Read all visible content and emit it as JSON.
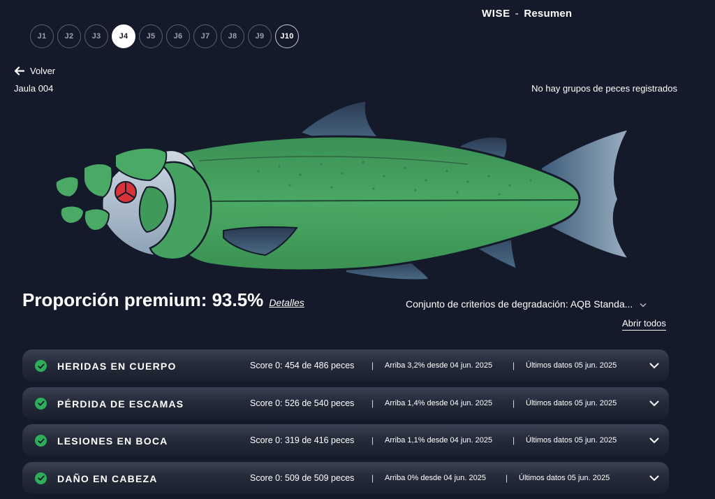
{
  "header": {
    "app": "WISE",
    "separator": "-",
    "section": "Resumen"
  },
  "cage_tabs": [
    {
      "label": "J1"
    },
    {
      "label": "J2"
    },
    {
      "label": "J3"
    },
    {
      "label": "J4"
    },
    {
      "label": "J5"
    },
    {
      "label": "J6"
    },
    {
      "label": "J7"
    },
    {
      "label": "J8"
    },
    {
      "label": "J9"
    },
    {
      "label": "J10"
    }
  ],
  "selected_cage": "J4",
  "nav": {
    "back_label": "Volver"
  },
  "cage": {
    "name": "Jaula 004"
  },
  "fish_groups": {
    "empty_message": "No hay grupos de peces registrados"
  },
  "summary": {
    "premium_label": "Proporción premium: 93.5%",
    "premium_value": 93.5,
    "details_link": "Detalles"
  },
  "criteria": {
    "label": "Conjunto de criterios de degradación: AQB Standa..."
  },
  "actions": {
    "open_all": "Abrir todos"
  },
  "colors": {
    "background": "#141a2a",
    "ok_green": "#2fae5a",
    "fish_green": "#3fa35a",
    "alert_red": "#d8323a"
  },
  "categories": [
    {
      "name": "HERIDAS EN CUERPO",
      "status": "ok",
      "score": "Score 0: 454 de 486 peces",
      "trend": "Arriba 3,2%  desde 04 jun. 2025",
      "latest": "Últimos datos 05 jun. 2025"
    },
    {
      "name": "PÉRDIDA DE ESCAMAS",
      "status": "ok",
      "score": "Score 0: 526 de 540 peces",
      "trend": "Arriba 1,4%  desde 04 jun. 2025",
      "latest": "Últimos datos 05 jun. 2025"
    },
    {
      "name": "LESIONES EN BOCA",
      "status": "ok",
      "score": "Score 0: 319 de 416 peces",
      "trend": "Arriba 1,1%  desde 04 jun. 2025",
      "latest": "Últimos datos 05 jun. 2025"
    },
    {
      "name": "DAÑO EN CABEZA",
      "status": "ok",
      "score": "Score 0: 509 de 509 peces",
      "trend": "Arriba 0%  desde 04 jun. 2025",
      "latest": "Últimos datos 05 jun. 2025"
    }
  ]
}
